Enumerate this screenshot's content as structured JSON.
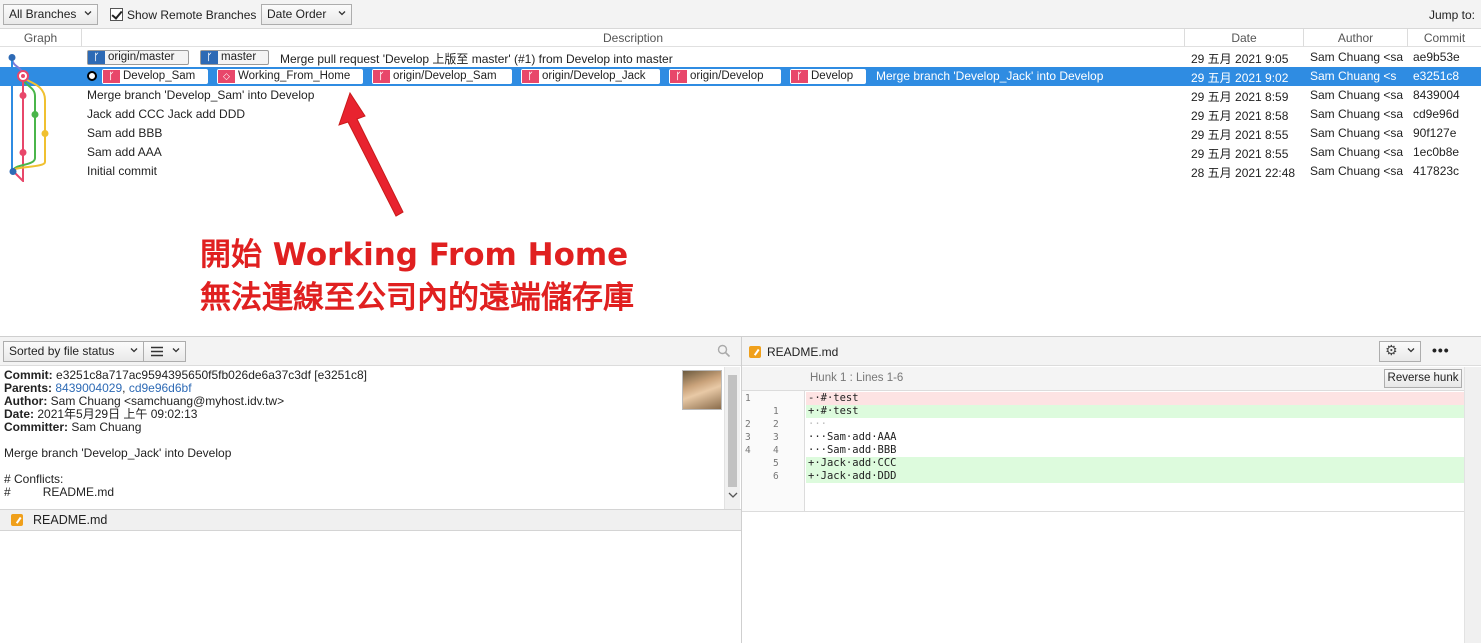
{
  "toolbar": {
    "branches_select": "All Branches",
    "show_remote_label": "Show Remote Branches",
    "order_select": "Date Order",
    "jump_to": "Jump to:"
  },
  "columns": {
    "graph": "Graph",
    "description": "Description",
    "date": "Date",
    "author": "Author",
    "commit": "Commit"
  },
  "commits": [
    {
      "tags": [
        {
          "label": "origin/master",
          "kind": "branch-remote"
        },
        {
          "label": "master",
          "kind": "branch-local"
        }
      ],
      "message": "Merge pull request 'Develop 上版至 master' (#1) from Develop into master",
      "date": "29 五月 2021 9:05",
      "author": "Sam Chuang <sa",
      "hash": "ae9b53e"
    },
    {
      "selected": true,
      "tags": [
        {
          "label": "Develop_Sam"
        },
        {
          "label": "Working_From_Home"
        },
        {
          "label": "origin/Develop_Sam"
        },
        {
          "label": "origin/Develop_Jack"
        },
        {
          "label": "origin/Develop"
        },
        {
          "label": "Develop"
        }
      ],
      "message": "Merge branch 'Develop_Jack' into Develop",
      "date": "29 五月 2021 9:02",
      "author": "Sam Chuang <s",
      "hash": "e3251c8"
    },
    {
      "message": "Merge branch 'Develop_Sam' into Develop",
      "date": "29 五月 2021 8:59",
      "author": "Sam Chuang <sa",
      "hash": "8439004"
    },
    {
      "message": "Jack add CCC Jack add DDD",
      "date": "29 五月 2021 8:58",
      "author": "Sam Chuang <sa",
      "hash": "cd9e96d"
    },
    {
      "message": "Sam add BBB",
      "date": "29 五月 2021 8:55",
      "author": "Sam Chuang <sa",
      "hash": "90f127e"
    },
    {
      "message": "Sam add AAA",
      "date": "29 五月 2021 8:55",
      "author": "Sam Chuang <sa",
      "hash": "1ec0b8e"
    },
    {
      "message": "Initial commit",
      "date": "28 五月 2021 22:48",
      "author": "Sam Chuang <sa",
      "hash": "417823c"
    }
  ],
  "annotation": {
    "line1": "開始 Working From Home",
    "line2": "無法連線至公司內的遠端儲存庫"
  },
  "file_status": {
    "sort_select": "Sorted by file status"
  },
  "commit_info": {
    "commit_label": "Commit:",
    "commit_value": "e3251c8a717ac9594395650f5fb026de6a37c3df [e3251c8]",
    "parents_label": "Parents:",
    "parent1": "8439004029",
    "parent_sep": ",",
    "parent2": "cd9e96d6bf",
    "author_label": "Author:",
    "author_value": "Sam Chuang <samchuang@myhost.idv.tw>",
    "date_label": "Date:",
    "date_value": "2021年5月29日 上午 09:02:13",
    "committer_label": "Committer:",
    "committer_value": "Sam Chuang",
    "message": "Merge branch 'Develop_Jack' into Develop",
    "conflicts_header": "# Conflicts:",
    "conflict_hash": "#",
    "conflict_file": "README.md"
  },
  "changed_file": "README.md",
  "diff": {
    "file": "README.md",
    "hunk_header": "Hunk 1 : Lines 1-6",
    "reverse_button": "Reverse hunk",
    "lines": [
      {
        "old": "1",
        "new": "",
        "type": "del",
        "text": "-·#·test"
      },
      {
        "old": "",
        "new": "1",
        "type": "add",
        "text": "+·#·test"
      },
      {
        "old": "2",
        "new": "2",
        "type": "ctx",
        "text": "···"
      },
      {
        "old": "3",
        "new": "3",
        "type": "ctx",
        "text": "···Sam·add·AAA"
      },
      {
        "old": "4",
        "new": "4",
        "type": "ctx",
        "text": "···Sam·add·BBB"
      },
      {
        "old": "",
        "new": "5",
        "type": "add",
        "text": "+·Jack·add·CCC"
      },
      {
        "old": "",
        "new": "6",
        "type": "add",
        "text": "+·Jack·add·DDD"
      }
    ]
  },
  "colors": {
    "selection": "#2f8ce2",
    "annotation": "#e02020",
    "branch_blue": "#2d6ab5",
    "branch_red": "#e8476a",
    "graph_lines": [
      "#2f8ce2",
      "#e8476a",
      "#4ab54a",
      "#f0c030",
      "#7a7ad8"
    ]
  }
}
